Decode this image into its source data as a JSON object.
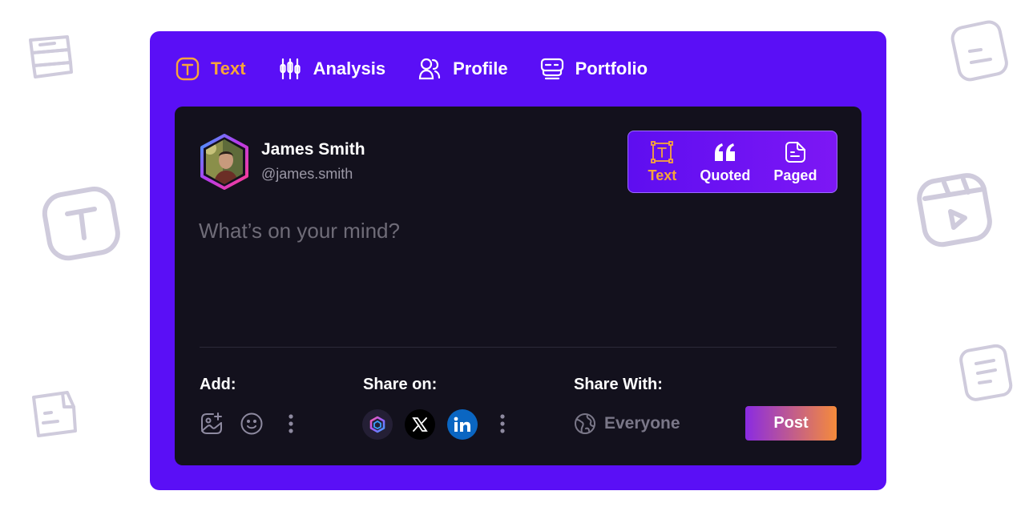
{
  "nav": {
    "items": [
      {
        "label": "Text",
        "icon": "text-box-icon",
        "active": true
      },
      {
        "label": "Analysis",
        "icon": "candles-icon",
        "active": false
      },
      {
        "label": "Profile",
        "icon": "users-icon",
        "active": false
      },
      {
        "label": "Portfolio",
        "icon": "stack-icon",
        "active": false
      }
    ]
  },
  "user": {
    "name": "James Smith",
    "handle": "@james.smith"
  },
  "modes": [
    {
      "label": "Text",
      "icon": "text-frame-icon",
      "active": true
    },
    {
      "label": "Quoted",
      "icon": "quote-icon",
      "active": false
    },
    {
      "label": "Paged",
      "icon": "page-icon",
      "active": false
    }
  ],
  "composer": {
    "placeholder": "What’s on your mind?"
  },
  "footer": {
    "add_label": "Add:",
    "share_on_label": "Share on:",
    "share_with_label": "Share With:",
    "audience": "Everyone",
    "post_label": "Post"
  },
  "colors": {
    "frame": "#5a0ff6",
    "card": "#13111d",
    "accent": "#f7a53a",
    "linkedin": "#0a66c2"
  }
}
